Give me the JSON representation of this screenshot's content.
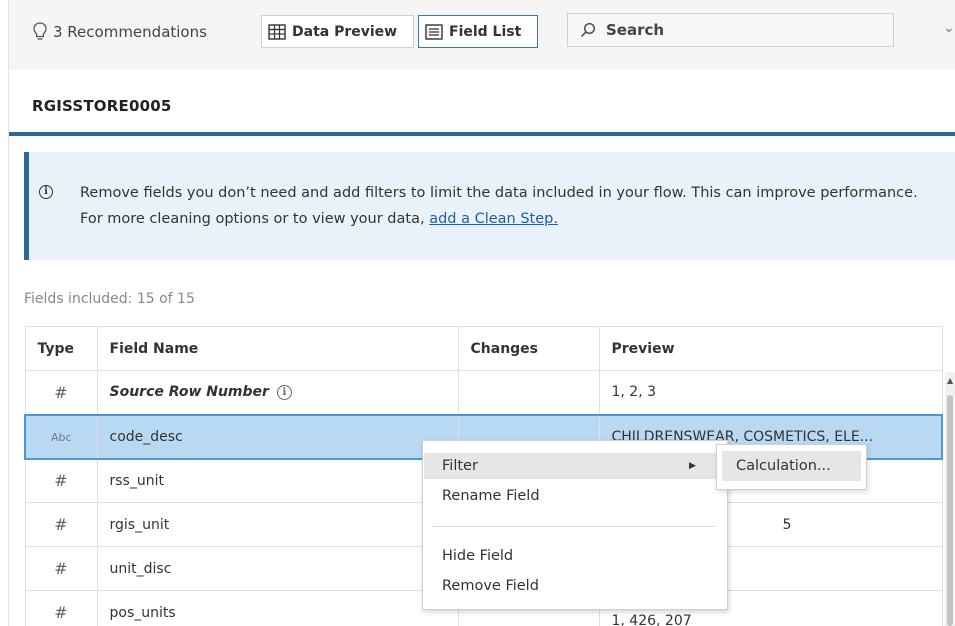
{
  "toolbar": {
    "recommendations": "3 Recommendations",
    "data_preview": "Data Preview",
    "field_list": "Field List",
    "search": "Search"
  },
  "title": "RGISSTORE0005",
  "info": {
    "text": "Remove fields you don’t need and add filters to limit the data included in your flow. This can improve performance. For more cleaning options or to view your data, ",
    "link": "add a Clean Step."
  },
  "fields_count": "Fields included: 15 of 15",
  "table": {
    "headers": [
      "Type",
      "Field Name",
      "Changes",
      "Preview"
    ],
    "rows": [
      {
        "type": "#",
        "name": "Source Row Number",
        "changes": "",
        "preview": "1, 2, 3"
      },
      {
        "type": "Abc",
        "name": "code_desc",
        "changes": "",
        "preview": "CHILDRENSWEAR, COSMETICS, ELE..."
      },
      {
        "type": "#",
        "name": "rss_unit",
        "changes": "",
        "preview": ""
      },
      {
        "type": "#",
        "name": "rgis_unit",
        "changes": "",
        "preview": "5"
      },
      {
        "type": "#",
        "name": "unit_disc",
        "changes": "",
        "preview": ""
      },
      {
        "type": "#",
        "name": "pos_units",
        "changes": "",
        "preview": "1, 426, 207"
      }
    ]
  },
  "context_menu": {
    "items": [
      "Filter",
      "Rename Field",
      "Hide Field",
      "Remove Field"
    ],
    "submenu": [
      "Calculation..."
    ]
  },
  "colors": {
    "accent": "#2a6a98",
    "selection": "#b9d9f2",
    "info_bg": "#e9f2fb",
    "link": "#1d5ea8"
  }
}
